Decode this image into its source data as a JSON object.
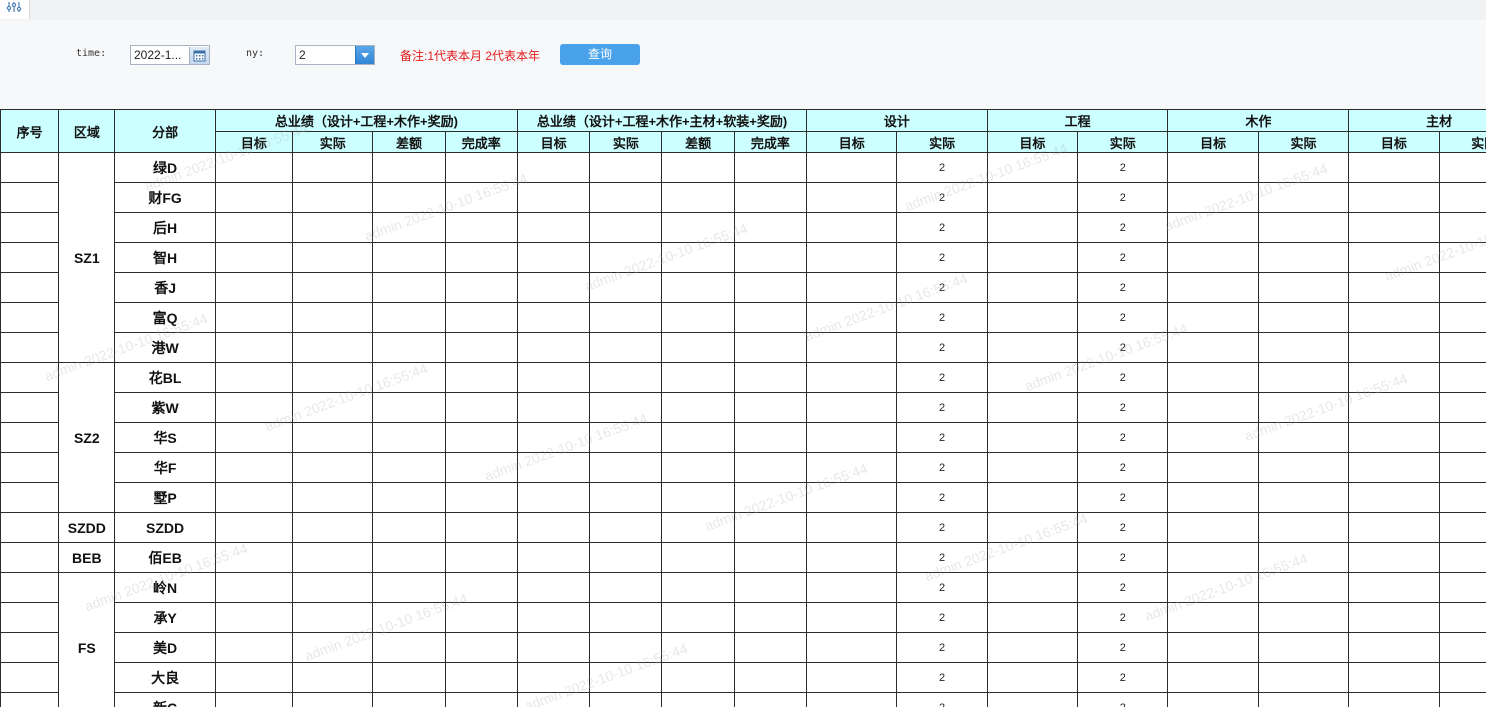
{
  "filter": {
    "time_label": "time:",
    "time_value": "2022-1...",
    "ny_label": "ny:",
    "ny_value": "2",
    "note": "备注:1代表本月 2代表本年",
    "query_button": "查询"
  },
  "table": {
    "fixed_headers": [
      "序号",
      "区域",
      "分部"
    ],
    "groups": [
      {
        "label": "总业绩（设计+工程+木作+奖励)",
        "subs": [
          "目标",
          "实际",
          "差额",
          "完成率"
        ]
      },
      {
        "label": "总业绩（设计+工程+木作+主材+软装+奖励)",
        "subs": [
          "目标",
          "实际",
          "差额",
          "完成率"
        ]
      },
      {
        "label": "设计",
        "subs": [
          "目标",
          "实际"
        ]
      },
      {
        "label": "工程",
        "subs": [
          "目标",
          "实际"
        ]
      },
      {
        "label": "木作",
        "subs": [
          "目标",
          "实际"
        ]
      },
      {
        "label": "主材",
        "subs": [
          "目标",
          "实际"
        ]
      }
    ],
    "regions": [
      {
        "name": "SZ1",
        "branches": [
          "绿D",
          "财FG",
          "后H",
          "智H",
          "香J",
          "富Q",
          "港W"
        ]
      },
      {
        "name": "SZ2",
        "branches": [
          "花BL",
          "紫W",
          "华S",
          "华F",
          "墅P"
        ]
      },
      {
        "name": "SZDD",
        "branches": [
          "SZDD"
        ]
      },
      {
        "name": "BEB",
        "branches": [
          "佰EB"
        ]
      },
      {
        "name": "FS",
        "branches": [
          "岭N",
          "承Y",
          "美D",
          "大良",
          "新C"
        ]
      }
    ],
    "design_actual": "2",
    "engineering_actual": "2"
  },
  "watermark": "admin 2022-10-10 16:55:44"
}
